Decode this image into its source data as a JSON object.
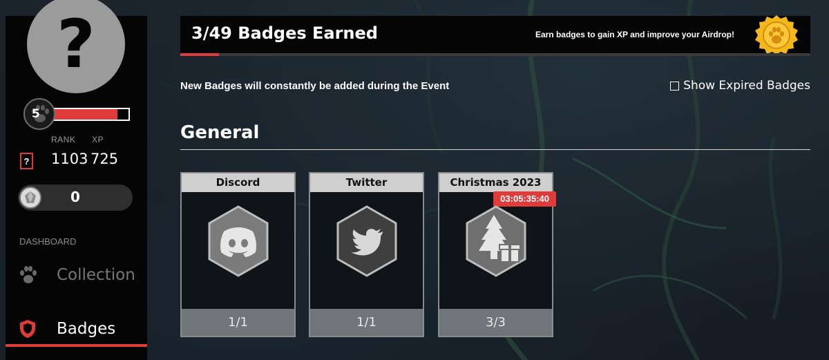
{
  "colors": {
    "accent": "#e03b3b",
    "panel": "#050505",
    "card_progress": "#707579"
  },
  "profile": {
    "avatar_glyph": "?",
    "level": "5",
    "xp_progress": 0.85,
    "rank_label": "RANK",
    "xp_label": "XP",
    "rank_value": "1103",
    "xp_value": "725",
    "unknown_glyph": "?",
    "gem_count": "0"
  },
  "nav": {
    "section": "DASHBOARD",
    "items": [
      {
        "label": "Collection",
        "icon": "paw-icon",
        "active": false
      },
      {
        "label": "Badges",
        "icon": "shield-icon",
        "active": true
      }
    ]
  },
  "header": {
    "title": "3/49 Badges Earned",
    "subtitle": "Earn badges to gain XP and improve your Airdrop!",
    "progress": 0.061,
    "medal_icon": "paw-medal-icon"
  },
  "info_text": "New Badges will constantly be added during the Event",
  "expired_toggle": {
    "label": "Show Expired Badges",
    "checked": false
  },
  "section_title": "General",
  "badges": [
    {
      "title": "Discord",
      "icon": "discord-icon",
      "progress": "1/1"
    },
    {
      "title": "Twitter",
      "icon": "twitter-icon",
      "progress": "1/1"
    },
    {
      "title": "Christmas 2023",
      "icon": "christmas-tree-gift-icon",
      "progress": "3/3",
      "timer": "03:05:35:40"
    }
  ]
}
